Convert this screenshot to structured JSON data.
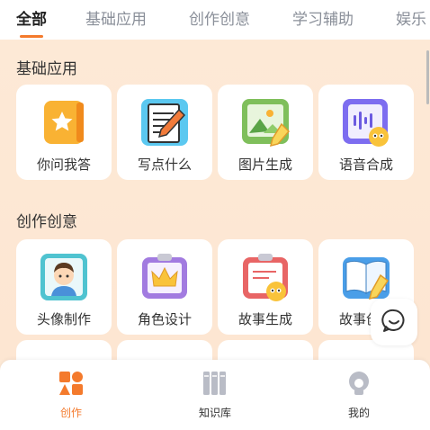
{
  "tabs": [
    {
      "label": "全部",
      "active": true
    },
    {
      "label": "基础应用",
      "active": false
    },
    {
      "label": "创作创意",
      "active": false
    },
    {
      "label": "学习辅助",
      "active": false
    },
    {
      "label": "娱乐",
      "active": false
    }
  ],
  "sections": [
    {
      "title": "基础应用",
      "items": [
        {
          "label": "你问我答",
          "icon": "star-book-icon"
        },
        {
          "label": "写点什么",
          "icon": "notepad-pencil-icon"
        },
        {
          "label": "图片生成",
          "icon": "image-brush-icon"
        },
        {
          "label": "语音合成",
          "icon": "voice-wave-icon"
        }
      ]
    },
    {
      "title": "创作创意",
      "items": [
        {
          "label": "头像制作",
          "icon": "avatar-boy-icon"
        },
        {
          "label": "角色设计",
          "icon": "crown-clipboard-icon"
        },
        {
          "label": "故事生成",
          "icon": "story-clipboard-icon"
        },
        {
          "label": "故事创作",
          "icon": "open-book-icon"
        }
      ]
    }
  ],
  "bottom_nav": [
    {
      "label": "创作",
      "icon": "shapes-icon",
      "active": true
    },
    {
      "label": "知识库",
      "icon": "books-icon",
      "active": false
    },
    {
      "label": "我的",
      "icon": "profile-icon",
      "active": false
    }
  ],
  "colors": {
    "accent": "#f47a2c",
    "background": "#fde9d6"
  }
}
